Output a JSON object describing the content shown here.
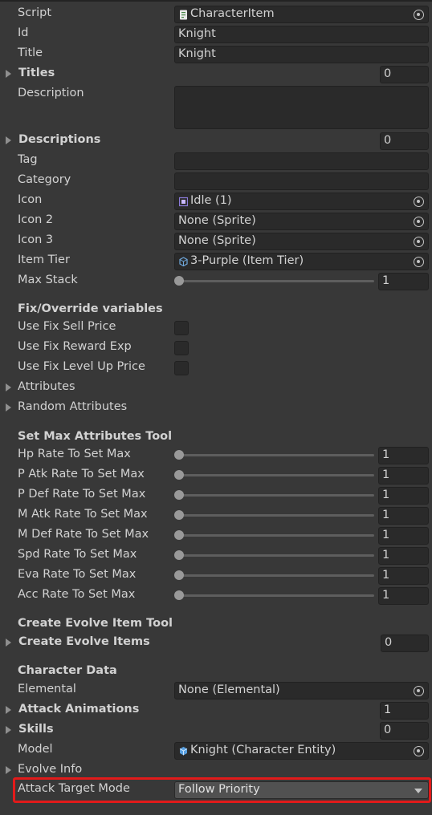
{
  "script": {
    "label": "Script",
    "value": "CharacterItem",
    "icon": "script-icon"
  },
  "id": {
    "label": "Id",
    "value": "Knight"
  },
  "title": {
    "label": "Title",
    "value": "Knight"
  },
  "titles": {
    "label": "Titles",
    "count": "0"
  },
  "description": {
    "label": "Description",
    "value": ""
  },
  "descriptions": {
    "label": "Descriptions",
    "count": "0"
  },
  "tag": {
    "label": "Tag",
    "value": ""
  },
  "category": {
    "label": "Category",
    "value": ""
  },
  "icon": {
    "label": "Icon",
    "value": "Idle (1)",
    "icon": "sprite-icon"
  },
  "icon2": {
    "label": "Icon 2",
    "value": "None (Sprite)"
  },
  "icon3": {
    "label": "Icon 3",
    "value": "None (Sprite)"
  },
  "item_tier": {
    "label": "Item Tier",
    "value": "3-Purple (Item Tier)",
    "icon": "scriptable-object-icon"
  },
  "max_stack": {
    "label": "Max Stack",
    "value": "1"
  },
  "fix_override": {
    "header": "Fix/Override variables",
    "use_fix_sell_price": {
      "label": "Use Fix Sell Price",
      "checked": false
    },
    "use_fix_reward_exp": {
      "label": "Use Fix Reward Exp",
      "checked": false
    },
    "use_fix_level_up_price": {
      "label": "Use Fix Level Up Price",
      "checked": false
    },
    "attributes": {
      "label": "Attributes"
    },
    "random_attributes": {
      "label": "Random Attributes"
    }
  },
  "set_max_tool": {
    "header": "Set Max Attributes Tool",
    "sliders": [
      {
        "label": "Hp Rate To Set Max",
        "value": "1"
      },
      {
        "label": "P Atk Rate To Set Max",
        "value": "1"
      },
      {
        "label": "P Def Rate To Set Max",
        "value": "1"
      },
      {
        "label": "M Atk Rate To Set Max",
        "value": "1"
      },
      {
        "label": "M Def Rate To Set Max",
        "value": "1"
      },
      {
        "label": "Spd Rate To Set Max",
        "value": "1"
      },
      {
        "label": "Eva Rate To Set Max",
        "value": "1"
      },
      {
        "label": "Acc Rate To Set Max",
        "value": "1"
      }
    ]
  },
  "evolve_tool": {
    "header": "Create Evolve Item Tool",
    "create_evolve_items": {
      "label": "Create Evolve Items",
      "count": "0"
    }
  },
  "character_data": {
    "header": "Character Data",
    "elemental": {
      "label": "Elemental",
      "value": "None (Elemental)"
    },
    "attack_animations": {
      "label": "Attack Animations",
      "count": "1"
    },
    "skills": {
      "label": "Skills",
      "count": "0"
    },
    "model": {
      "label": "Model",
      "value": "Knight (Character Entity)",
      "icon": "prefab-icon"
    },
    "evolve_info": {
      "label": "Evolve Info"
    },
    "attack_target_mode": {
      "label": "Attack Target Mode",
      "value": "Follow Priority"
    }
  },
  "colors": {
    "background": "#383838",
    "field": "#2a2a2a",
    "highlight": "#e21a1a"
  }
}
